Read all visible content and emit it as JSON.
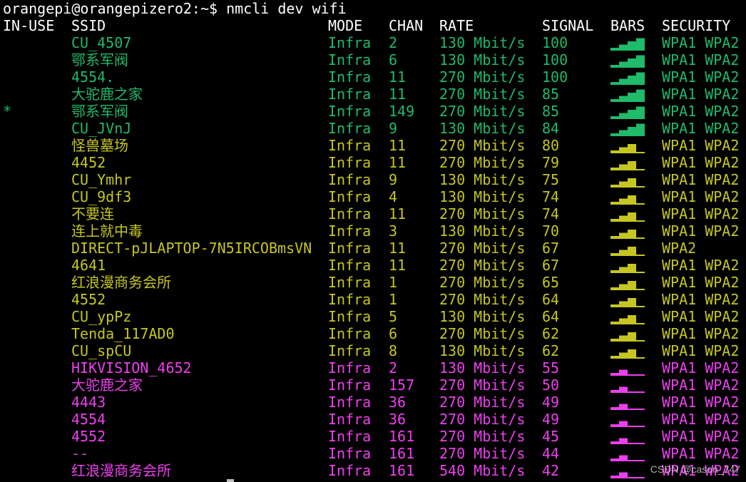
{
  "prompt": {
    "text": "orangepi@orangepizero2:~$ nmcli dev wifi"
  },
  "colors": {
    "header": "#ffffff",
    "strong": "#1fba6a",
    "medium": "#c6c623",
    "weak": "#ee3fee",
    "dim_bar": "#1c1c1c"
  },
  "header": {
    "in_use": "IN-USE",
    "ssid": "SSID",
    "mode": "MODE",
    "chan": "CHAN",
    "rate": "RATE",
    "signal": "SIGNAL",
    "bars": "BARS",
    "security": "SECURITY"
  },
  "networks": [
    {
      "in_use": "",
      "ssid": "CU_4507",
      "mode": "Infra",
      "chan": "2",
      "rate": "130 Mbit/s",
      "signal": "100",
      "bars": 4,
      "strength": "strong",
      "security": "WPA1 WPA2"
    },
    {
      "in_use": "",
      "ssid": "鄂系军阀",
      "mode": "Infra",
      "chan": "6",
      "rate": "130 Mbit/s",
      "signal": "100",
      "bars": 4,
      "strength": "strong",
      "security": "WPA1 WPA2"
    },
    {
      "in_use": "",
      "ssid": "4554.",
      "mode": "Infra",
      "chan": "11",
      "rate": "270 Mbit/s",
      "signal": "100",
      "bars": 4,
      "strength": "strong",
      "security": "WPA1 WPA2"
    },
    {
      "in_use": "",
      "ssid": "大驼鹿之家",
      "mode": "Infra",
      "chan": "11",
      "rate": "270 Mbit/s",
      "signal": "85",
      "bars": 4,
      "strength": "strong",
      "security": "WPA1 WPA2"
    },
    {
      "in_use": "*",
      "ssid": "鄂系军阀",
      "mode": "Infra",
      "chan": "149",
      "rate": "270 Mbit/s",
      "signal": "85",
      "bars": 4,
      "strength": "strong",
      "security": "WPA1 WPA2"
    },
    {
      "in_use": "",
      "ssid": "CU_JVnJ",
      "mode": "Infra",
      "chan": "9",
      "rate": "130 Mbit/s",
      "signal": "84",
      "bars": 4,
      "strength": "strong",
      "security": "WPA1 WPA2"
    },
    {
      "in_use": "",
      "ssid": "怪兽墓场",
      "mode": "Infra",
      "chan": "11",
      "rate": "270 Mbit/s",
      "signal": "80",
      "bars": 3,
      "strength": "medium",
      "security": "WPA1 WPA2"
    },
    {
      "in_use": "",
      "ssid": "4452",
      "mode": "Infra",
      "chan": "11",
      "rate": "270 Mbit/s",
      "signal": "79",
      "bars": 3,
      "strength": "medium",
      "security": "WPA1 WPA2"
    },
    {
      "in_use": "",
      "ssid": "CU_Ymhr",
      "mode": "Infra",
      "chan": "9",
      "rate": "130 Mbit/s",
      "signal": "75",
      "bars": 3,
      "strength": "medium",
      "security": "WPA1 WPA2"
    },
    {
      "in_use": "",
      "ssid": "CU_9df3",
      "mode": "Infra",
      "chan": "4",
      "rate": "130 Mbit/s",
      "signal": "74",
      "bars": 3,
      "strength": "medium",
      "security": "WPA1 WPA2"
    },
    {
      "in_use": "",
      "ssid": "不要连",
      "mode": "Infra",
      "chan": "11",
      "rate": "270 Mbit/s",
      "signal": "74",
      "bars": 3,
      "strength": "medium",
      "security": "WPA1 WPA2"
    },
    {
      "in_use": "",
      "ssid": "连上就中毒",
      "mode": "Infra",
      "chan": "3",
      "rate": "130 Mbit/s",
      "signal": "70",
      "bars": 3,
      "strength": "medium",
      "security": "WPA1 WPA2"
    },
    {
      "in_use": "",
      "ssid": "DIRECT-pJLAPTOP-7N5IRCOBmsVN",
      "mode": "Infra",
      "chan": "11",
      "rate": "270 Mbit/s",
      "signal": "67",
      "bars": 3,
      "strength": "medium",
      "security": "WPA2"
    },
    {
      "in_use": "",
      "ssid": "4641",
      "mode": "Infra",
      "chan": "11",
      "rate": "270 Mbit/s",
      "signal": "67",
      "bars": 3,
      "strength": "medium",
      "security": "WPA1 WPA2"
    },
    {
      "in_use": "",
      "ssid": "红浪漫商务会所",
      "mode": "Infra",
      "chan": "1",
      "rate": "270 Mbit/s",
      "signal": "65",
      "bars": 3,
      "strength": "medium",
      "security": "WPA1 WPA2"
    },
    {
      "in_use": "",
      "ssid": "4552",
      "mode": "Infra",
      "chan": "1",
      "rate": "270 Mbit/s",
      "signal": "64",
      "bars": 3,
      "strength": "medium",
      "security": "WPA1 WPA2"
    },
    {
      "in_use": "",
      "ssid": "CU_ypPz",
      "mode": "Infra",
      "chan": "5",
      "rate": "130 Mbit/s",
      "signal": "64",
      "bars": 3,
      "strength": "medium",
      "security": "WPA1 WPA2"
    },
    {
      "in_use": "",
      "ssid": "Tenda_117AD0",
      "mode": "Infra",
      "chan": "6",
      "rate": "270 Mbit/s",
      "signal": "62",
      "bars": 3,
      "strength": "medium",
      "security": "WPA1 WPA2"
    },
    {
      "in_use": "",
      "ssid": "CU_spCU",
      "mode": "Infra",
      "chan": "8",
      "rate": "130 Mbit/s",
      "signal": "62",
      "bars": 3,
      "strength": "medium",
      "security": "WPA1 WPA2"
    },
    {
      "in_use": "",
      "ssid": "HIKVISION_4652",
      "mode": "Infra",
      "chan": "2",
      "rate": "130 Mbit/s",
      "signal": "55",
      "bars": 2,
      "strength": "weak",
      "security": "WPA1 WPA2"
    },
    {
      "in_use": "",
      "ssid": "大驼鹿之家",
      "mode": "Infra",
      "chan": "157",
      "rate": "270 Mbit/s",
      "signal": "50",
      "bars": 2,
      "strength": "weak",
      "security": "WPA1 WPA2"
    },
    {
      "in_use": "",
      "ssid": "4443",
      "mode": "Infra",
      "chan": "36",
      "rate": "270 Mbit/s",
      "signal": "49",
      "bars": 2,
      "strength": "weak",
      "security": "WPA1 WPA2"
    },
    {
      "in_use": "",
      "ssid": "4554",
      "mode": "Infra",
      "chan": "36",
      "rate": "270 Mbit/s",
      "signal": "49",
      "bars": 2,
      "strength": "weak",
      "security": "WPA1 WPA2"
    },
    {
      "in_use": "",
      "ssid": "4552",
      "mode": "Infra",
      "chan": "161",
      "rate": "270 Mbit/s",
      "signal": "45",
      "bars": 2,
      "strength": "weak",
      "security": "WPA1 WPA2"
    },
    {
      "in_use": "",
      "ssid": "--",
      "mode": "Infra",
      "chan": "161",
      "rate": "270 Mbit/s",
      "signal": "44",
      "bars": 2,
      "strength": "weak",
      "security": "WPA1 WPA2"
    },
    {
      "in_use": "",
      "ssid": "红浪漫商务会所",
      "mode": "Infra",
      "chan": "161",
      "rate": "540 Mbit/s",
      "signal": "42",
      "bars": 2,
      "strength": "weak",
      "security": "WPA1 WPA2"
    }
  ],
  "watermark": {
    "text": "CSDN @cason_747"
  }
}
